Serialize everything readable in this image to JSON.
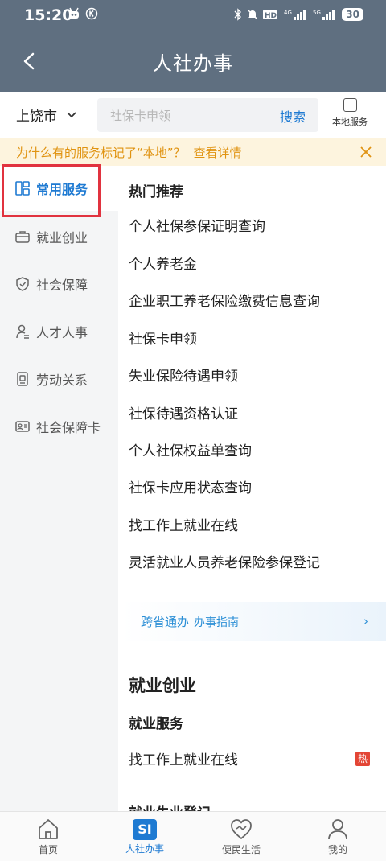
{
  "status_bar": {
    "time": "15:20",
    "left_icons": [
      "bot-icon",
      "k-circle-icon"
    ],
    "right_icons": [
      "bluetooth-icon",
      "mute-icon",
      "hd-icon",
      "4g-signal-icon",
      "5g-signal-icon"
    ],
    "battery": "30"
  },
  "header": {
    "title": "人社办事"
  },
  "search": {
    "city": "上饶市",
    "placeholder": "社保卡申领",
    "button": "搜索",
    "local_label": "本地服务"
  },
  "notice": {
    "text": "为什么有的服务标记了“本地”？",
    "link": "查看详情"
  },
  "sidebar": {
    "items": [
      {
        "label": "常用服务",
        "icon": "grid-icon",
        "active": true
      },
      {
        "label": "就业创业",
        "icon": "briefcase-icon"
      },
      {
        "label": "社会保障",
        "icon": "shield-icon"
      },
      {
        "label": "人才人事",
        "icon": "person-icon"
      },
      {
        "label": "劳动关系",
        "icon": "document-icon"
      },
      {
        "label": "社会保障卡",
        "icon": "id-card-icon"
      }
    ]
  },
  "main": {
    "section_title": "热门推荐",
    "services": [
      "个人社保参保证明查询",
      "个人养老金",
      "企业职工养老保险缴费信息查询",
      "社保卡申领",
      "失业保险待遇申领",
      "社保待遇资格认证",
      "个人社保权益单查询",
      "社保卡应用状态查询",
      "找工作上就业在线",
      "灵活就业人员养老保险参保登记"
    ],
    "banner": {
      "title": "跨省通办",
      "subtitle": "办事指南",
      "arrow": "›"
    },
    "group_title": "就业创业",
    "subgroup_title": "就业服务",
    "sub_services": [
      "找工作上就业在线"
    ],
    "hot_badge": "热",
    "next_subgroup": "就业失业登记"
  },
  "tabbar": {
    "tabs": [
      {
        "label": "首页",
        "icon": "home-icon"
      },
      {
        "label": "人社办事",
        "icon": "si-icon",
        "icon_text": "SI",
        "active": true
      },
      {
        "label": "便民生活",
        "icon": "handshake-heart-icon"
      },
      {
        "label": "我的",
        "icon": "user-icon"
      }
    ]
  },
  "colors": {
    "header": "#5f6f80",
    "accent": "#1e7ad2",
    "notice_text": "#e09311",
    "highlight": "#e1333f"
  }
}
